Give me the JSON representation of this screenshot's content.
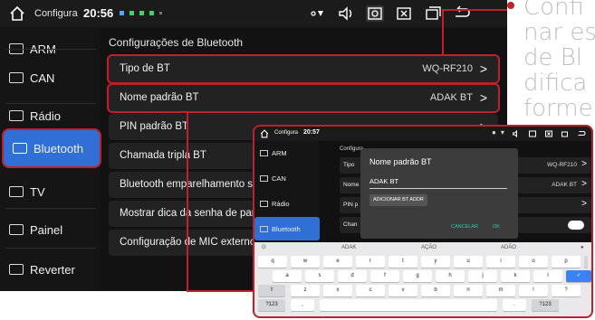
{
  "main": {
    "status": {
      "app": "Configura",
      "time": "20:56"
    },
    "sidebar": [
      {
        "label": "ARM",
        "icon": "arm-icon"
      },
      {
        "label": "CAN",
        "icon": "can-icon"
      },
      {
        "label": "Rádio",
        "icon": "radio-icon"
      },
      {
        "label": "Bluetooth",
        "icon": "bluetooth-icon",
        "active": true
      },
      {
        "label": "TV",
        "icon": "tv-icon"
      },
      {
        "label": "Painel",
        "icon": "panel-icon"
      },
      {
        "label": "Reverter",
        "icon": "reverse-icon"
      }
    ],
    "section_title": "Configurações de Bluetooth",
    "rows": [
      {
        "label": "Tipo de BT",
        "value": "WQ-RF210",
        "chevron": ">"
      },
      {
        "label": "Nome padrão BT",
        "value": "ADAK BT",
        "chevron": ">"
      },
      {
        "label": "PIN padrão BT",
        "value": "",
        "chevron": ">"
      },
      {
        "label": "Chamada tripla BT",
        "value": "",
        "chevron": ""
      },
      {
        "label": "Bluetooth emparelhamento simp",
        "value": "",
        "chevron": ""
      },
      {
        "label": "Mostrar dica da senha de parea",
        "value": "",
        "chevron": ""
      },
      {
        "label": "Configuração de MIC externo",
        "value": "",
        "chevron": ""
      }
    ]
  },
  "callout": {
    "lines": [
      "Confi",
      "nar es",
      "de Bl",
      "difica",
      "forme"
    ]
  },
  "inset": {
    "status": {
      "app": "Configura",
      "time": "20:57"
    },
    "sidebar": [
      "ARM",
      "CAN",
      "Rádio",
      "Bluetooth"
    ],
    "content_title": "Configura",
    "rows": [
      {
        "label": "Tipo",
        "value": "WQ-RF210",
        "chevron": ">"
      },
      {
        "label": "Nome",
        "value": "ADAK BT",
        "chevron": ">"
      },
      {
        "label": "PIN p",
        "value": "",
        "chevron": ">"
      },
      {
        "label": "Chan",
        "value": "",
        "chevron": ""
      }
    ],
    "dialog": {
      "title": "Nome padrão BT",
      "input_value": "ADAK BT",
      "add_button": "ADICIONAR BT ADDR",
      "cancel": "CANCELAR",
      "ok": "OK"
    },
    "keyboard": {
      "suggestions": [
        "G",
        "ADAK",
        "AÇÃO",
        "ADÃO"
      ],
      "row1": [
        "q",
        "w",
        "e",
        "r",
        "t",
        "y",
        "u",
        "i",
        "o",
        "p"
      ],
      "row2": [
        "a",
        "s",
        "d",
        "f",
        "g",
        "h",
        "j",
        "k",
        "l"
      ],
      "row3": [
        "z",
        "x",
        "c",
        "v",
        "b",
        "n",
        "m",
        "!",
        "?"
      ],
      "symbols": "?123",
      "comma": ",",
      "period": "."
    }
  },
  "colors": {
    "accent": "#c0202a",
    "active": "#2f6fd6",
    "ok": "#35c7a8"
  }
}
